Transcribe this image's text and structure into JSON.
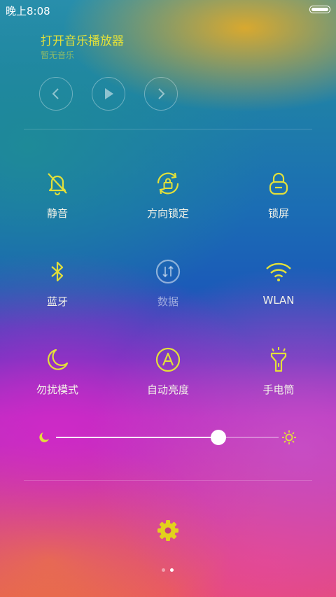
{
  "status": {
    "time": "晚上8:08"
  },
  "music": {
    "title": "打开音乐播放器",
    "subtitle": "暂无音乐",
    "controls": [
      "chevron-left-icon",
      "play-icon",
      "chevron-right-icon"
    ]
  },
  "toggles": [
    {
      "label": "静音",
      "icon": "bell-off-icon"
    },
    {
      "label": "方向锁定",
      "icon": "rotation-lock-icon"
    },
    {
      "label": "锁屏",
      "icon": "lock-icon"
    },
    {
      "label": "蓝牙",
      "icon": "bluetooth-icon"
    },
    {
      "label": "数据",
      "icon": "data-icon"
    },
    {
      "label": "WLAN",
      "icon": "wifi-icon"
    },
    {
      "label": "勿扰模式",
      "icon": "moon-icon"
    },
    {
      "label": "自动亮度",
      "icon": "auto-brightness-icon"
    },
    {
      "label": "手电筒",
      "icon": "flashlight-icon"
    }
  ],
  "brightness": {
    "level": 0.73
  },
  "pager": {
    "pages": 2,
    "active": 2
  },
  "colors": {
    "accent": "#e2e03a",
    "text": "#f3f3e8",
    "dimmed": "rgba(255,255,255,0.5)"
  }
}
